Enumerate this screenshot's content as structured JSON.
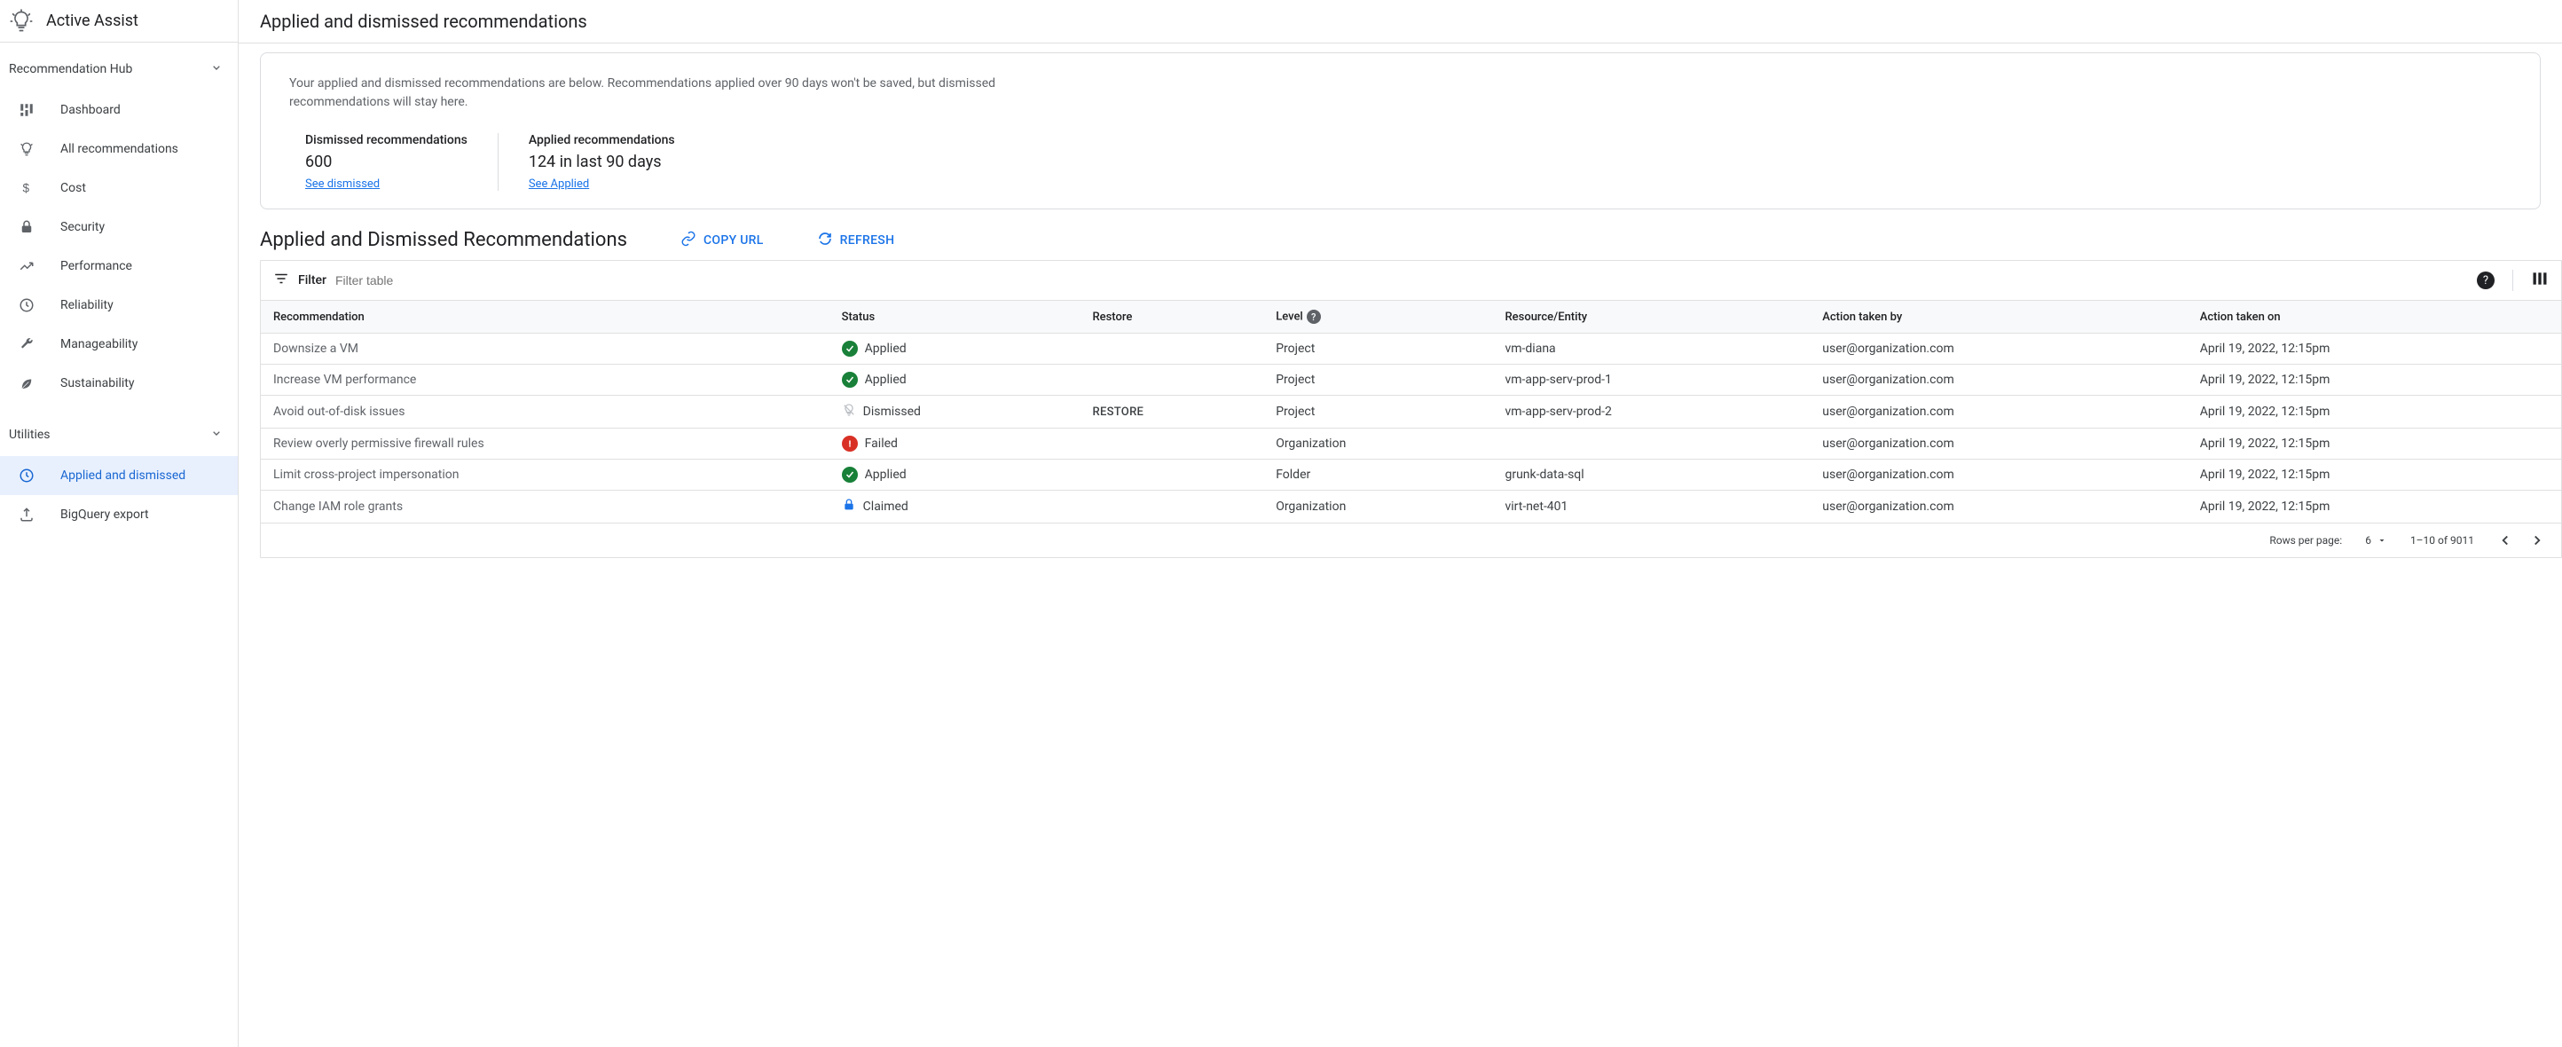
{
  "product": {
    "name": "Active Assist"
  },
  "sidebar": {
    "sections": [
      {
        "label": "Recommendation Hub",
        "items": [
          {
            "label": "Dashboard",
            "icon": "dashboard"
          },
          {
            "label": "All recommendations",
            "icon": "lightbulb"
          },
          {
            "label": "Cost",
            "icon": "dollar"
          },
          {
            "label": "Security",
            "icon": "lock"
          },
          {
            "label": "Performance",
            "icon": "trend"
          },
          {
            "label": "Reliability",
            "icon": "clock"
          },
          {
            "label": "Manageability",
            "icon": "wrench"
          },
          {
            "label": "Sustainability",
            "icon": "leaf"
          }
        ]
      },
      {
        "label": "Utilities",
        "items": [
          {
            "label": "Applied and dismissed",
            "icon": "history",
            "active": true
          },
          {
            "label": "BigQuery export",
            "icon": "export"
          }
        ]
      }
    ]
  },
  "page": {
    "title": "Applied and dismissed recommendations",
    "summary_text": "Your applied and dismissed recommendations are below. Recommendations applied over 90 days won't be saved, but dismissed recommendations will stay here.",
    "stats": [
      {
        "label": "Dismissed recommendations",
        "value": "600",
        "link": "See dismissed"
      },
      {
        "label": "Applied recommendations",
        "value": "124 in last 90 days",
        "link": "See Applied"
      }
    ],
    "section_title": "Applied and Dismissed Recommendations",
    "actions": {
      "copy_url": "COPY URL",
      "refresh": "REFRESH"
    },
    "filter": {
      "label": "Filter",
      "placeholder": "Filter table"
    },
    "columns": [
      "Recommendation",
      "Status",
      "Restore",
      "Level",
      "Resource/Entity",
      "Action taken by",
      "Action taken on"
    ],
    "rows": [
      {
        "rec": "Downsize a VM",
        "status": "Applied",
        "status_type": "applied",
        "restore": "",
        "level": "Project",
        "resource": "vm-diana",
        "by": "user@organization.com",
        "on": "April 19, 2022, 12:15pm"
      },
      {
        "rec": "Increase VM performance",
        "status": "Applied",
        "status_type": "applied",
        "restore": "",
        "level": "Project",
        "resource": "vm-app-serv-prod-1",
        "by": "user@organization.com",
        "on": "April 19, 2022, 12:15pm"
      },
      {
        "rec": "Avoid out-of-disk issues",
        "status": "Dismissed",
        "status_type": "dismissed",
        "restore": "RESTORE",
        "level": "Project",
        "resource": "vm-app-serv-prod-2",
        "by": "user@organization.com",
        "on": "April 19, 2022, 12:15pm"
      },
      {
        "rec": "Review overly permissive firewall rules",
        "status": "Failed",
        "status_type": "failed",
        "restore": "",
        "level": "Organization",
        "resource": "",
        "by": "user@organization.com",
        "on": "April 19, 2022, 12:15pm"
      },
      {
        "rec": "Limit cross-project impersonation",
        "status": "Applied",
        "status_type": "applied",
        "restore": "",
        "level": "Folder",
        "resource": "grunk-data-sql",
        "by": "user@organization.com",
        "on": "April 19, 2022, 12:15pm"
      },
      {
        "rec": "Change IAM role grants",
        "status": "Claimed",
        "status_type": "claimed",
        "restore": "",
        "level": "Organization",
        "resource": "virt-net-401",
        "by": "user@organization.com",
        "on": "April 19, 2022, 12:15pm"
      }
    ],
    "pagination": {
      "rows_label": "Rows per page:",
      "rows_value": "6",
      "range": "1–10 of 9011"
    }
  }
}
